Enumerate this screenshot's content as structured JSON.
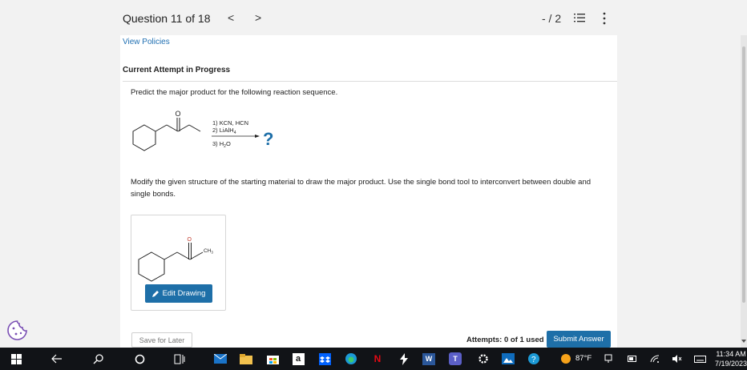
{
  "header": {
    "question_label": "Question 11 of 18",
    "prev_glyph": "<",
    "next_glyph": ">",
    "score": "- / 2"
  },
  "panel": {
    "view_policies": "View Policies",
    "attempt_heading": "Current Attempt in Progress",
    "prompt": "Predict the major product for the following reaction sequence.",
    "reagents": {
      "step1": "1) KCN, HCN",
      "step2_main": "2) LiAlH",
      "step2_sub": "4",
      "step3_main": "3) H",
      "step3_sub": "2",
      "step3_end": "O",
      "question_mark": "?"
    },
    "starting_material": {
      "carbonyl_atom": "O"
    },
    "instructions": "Modify the given structure of the starting material to draw the major product. Use the single bond tool to interconvert between double and single bonds.",
    "drawing": {
      "atom_o": "O",
      "atom_ch3_main": "CH",
      "atom_ch3_sub": "3",
      "edit_label": "Edit Drawing"
    },
    "footer": {
      "save_later": "Save for Later",
      "attempts_label": "Attempts: 0 of 1 used",
      "submit": "Submit Answer"
    }
  },
  "taskbar": {
    "temperature": "87°F",
    "time": "11:34 AM",
    "date": "7/19/2023",
    "amazon_glyph": "a",
    "word_glyph": "W",
    "netflix_glyph": "N",
    "teams_glyph": "T"
  },
  "colors": {
    "accent": "#1e6fa8",
    "link": "#1f6fb2",
    "taskbar": "#111317",
    "question_mark": "#1e6fa8"
  }
}
